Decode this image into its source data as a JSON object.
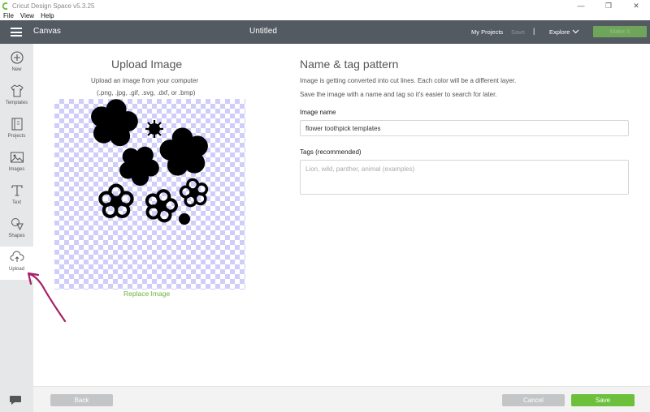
{
  "window": {
    "title": "Cricut Design Space  v5.3.25",
    "minimize": "—",
    "maximize": "❐",
    "close": "✕"
  },
  "menu": [
    "File",
    "View",
    "Help"
  ],
  "header": {
    "section": "Canvas",
    "document_title": "Untitled",
    "my_projects": "My Projects",
    "save": "Save",
    "separator": "|",
    "explore": "Explore",
    "make_it": "Make It"
  },
  "sidebar": {
    "items": [
      {
        "label": "New",
        "icon": "plus-circle-icon"
      },
      {
        "label": "Templates",
        "icon": "shirt-icon"
      },
      {
        "label": "Projects",
        "icon": "book-icon"
      },
      {
        "label": "Images",
        "icon": "image-icon"
      },
      {
        "label": "Text",
        "icon": "text-icon"
      },
      {
        "label": "Shapes",
        "icon": "shapes-icon"
      },
      {
        "label": "Upload",
        "icon": "cloud-upload-icon",
        "active": true
      }
    ]
  },
  "upload": {
    "title": "Upload Image",
    "subtitle": "Upload an image from your computer",
    "formats": "(.png, .jpg, .gif, .svg, .dxf, or .bmp)",
    "replace_link": "Replace Image"
  },
  "tag_pattern": {
    "title": "Name & tag pattern",
    "desc1": "Image is getting converted into cut lines. Each color will be a different layer.",
    "desc2": "Save the image with a name and tag so it's easier to search for later.",
    "image_name_label": "Image name",
    "image_name_value": "flower toothpick templates",
    "tags_label": "Tags (recommended)",
    "tags_placeholder": "Lion, wild, panther, animal (examples)"
  },
  "footer": {
    "back": "Back",
    "cancel": "Cancel",
    "save": "Save"
  },
  "colors": {
    "header_bg": "#535a62",
    "accent_green": "#6cc03c",
    "annotation_arrow": "#a8206b"
  }
}
